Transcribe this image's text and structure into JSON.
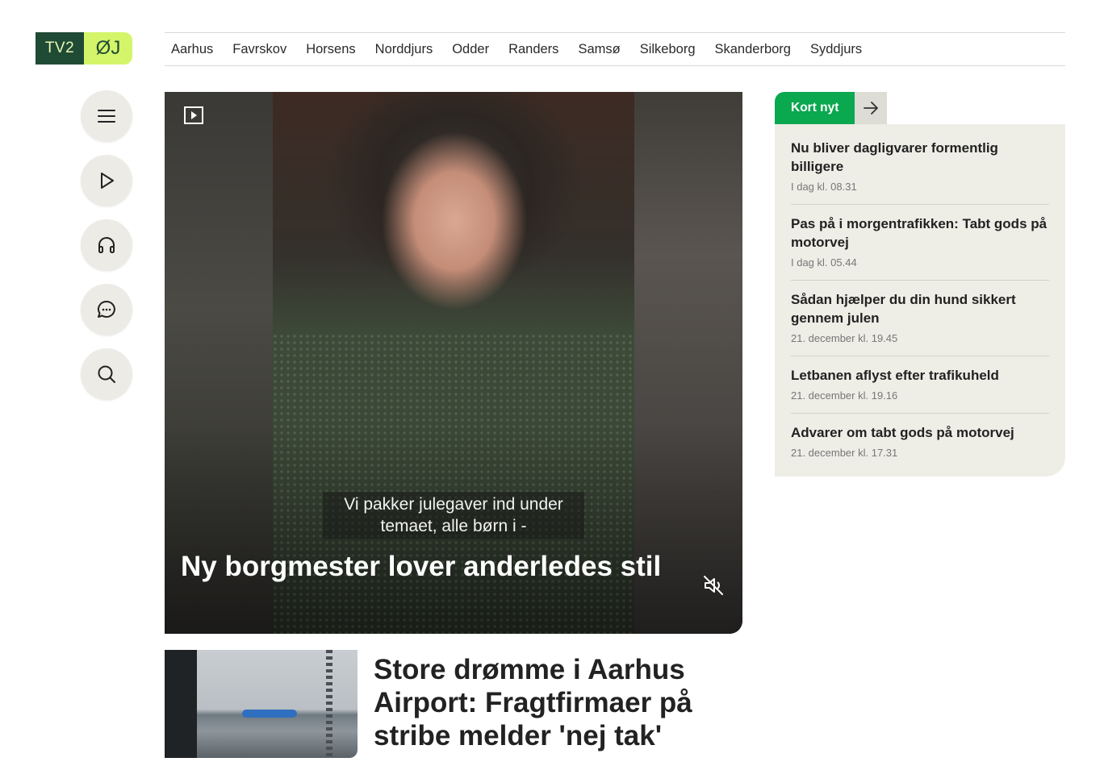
{
  "logo": {
    "left": "TV2",
    "right": "ØJ"
  },
  "nav": [
    "Aarhus",
    "Favrskov",
    "Horsens",
    "Norddjurs",
    "Odder",
    "Randers",
    "Samsø",
    "Silkeborg",
    "Skanderborg",
    "Syddjurs"
  ],
  "side_buttons": [
    "menu-icon",
    "play-icon",
    "headphones-icon",
    "chat-icon",
    "search-icon"
  ],
  "hero": {
    "subtitle_line1": "Vi pakker julegaver ind under",
    "subtitle_line2": "temaet, alle børn i -",
    "headline": "Ny borgmester lover anderledes stil",
    "badge_icon": "video-play-icon",
    "mute_icon": "muted-speaker-icon"
  },
  "article2": {
    "title": "Store drømme i Aarhus Airport: Fragtfirmaer på stribe melder 'nej tak'"
  },
  "kort_nyt": {
    "label": "Kort nyt",
    "items": [
      {
        "title": "Nu bliver dagligvarer formentlig billigere",
        "date": "I dag kl. 08.31"
      },
      {
        "title": "Pas på i morgentrafikken: Tabt gods på motorvej",
        "date": "I dag kl. 05.44"
      },
      {
        "title": "Sådan hjælper du din hund sikkert gennem julen",
        "date": "21. december kl. 19.45"
      },
      {
        "title": "Letbanen aflyst efter trafikuheld",
        "date": "21. december kl. 19.16"
      },
      {
        "title": "Advarer om tabt gods på motorvej",
        "date": "21. december kl. 17.31"
      }
    ]
  },
  "colors": {
    "brand_dark": "#1f4a34",
    "brand_lime": "#d4f56a",
    "accent_green": "#0aa84f",
    "panel": "#eeede6"
  }
}
